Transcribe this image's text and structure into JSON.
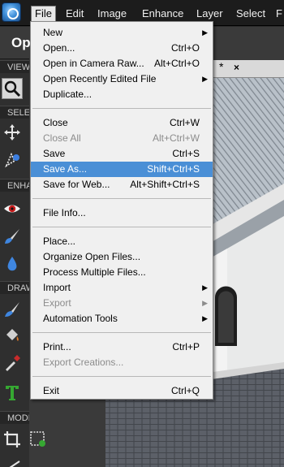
{
  "menubar": {
    "items": [
      "File",
      "Edit",
      "Image",
      "Enhance",
      "Layer",
      "Select",
      "F"
    ]
  },
  "left_panel": {
    "mode": "Op",
    "labels": {
      "view": "VIEW",
      "select": "SELECT",
      "enhance": "ENHANCE",
      "draw": "DRAW",
      "modify": "MODIFY"
    }
  },
  "document_tab": {
    "modified": "*",
    "close": "×"
  },
  "file_menu": {
    "groups": [
      [
        {
          "label": "New",
          "shortcut": "",
          "submenu": true,
          "disabled": false
        },
        {
          "label": "Open...",
          "shortcut": "Ctrl+O",
          "submenu": false,
          "disabled": false
        },
        {
          "label": "Open in Camera Raw...",
          "shortcut": "Alt+Ctrl+O",
          "submenu": false,
          "disabled": false
        },
        {
          "label": "Open Recently Edited File",
          "shortcut": "",
          "submenu": true,
          "disabled": false
        },
        {
          "label": "Duplicate...",
          "shortcut": "",
          "submenu": false,
          "disabled": false
        }
      ],
      [
        {
          "label": "Close",
          "shortcut": "Ctrl+W",
          "submenu": false,
          "disabled": false
        },
        {
          "label": "Close All",
          "shortcut": "Alt+Ctrl+W",
          "submenu": false,
          "disabled": true
        },
        {
          "label": "Save",
          "shortcut": "Ctrl+S",
          "submenu": false,
          "disabled": false
        },
        {
          "label": "Save As...",
          "shortcut": "Shift+Ctrl+S",
          "submenu": false,
          "disabled": false,
          "highlighted": true
        },
        {
          "label": "Save for Web...",
          "shortcut": "Alt+Shift+Ctrl+S",
          "submenu": false,
          "disabled": false
        }
      ],
      [
        {
          "label": "File Info...",
          "shortcut": "",
          "submenu": false,
          "disabled": false
        }
      ],
      [
        {
          "label": "Place...",
          "shortcut": "",
          "submenu": false,
          "disabled": false
        },
        {
          "label": "Organize Open Files...",
          "shortcut": "",
          "submenu": false,
          "disabled": false
        },
        {
          "label": "Process Multiple Files...",
          "shortcut": "",
          "submenu": false,
          "disabled": false
        },
        {
          "label": "Import",
          "shortcut": "",
          "submenu": true,
          "disabled": false
        },
        {
          "label": "Export",
          "shortcut": "",
          "submenu": true,
          "disabled": true
        },
        {
          "label": "Automation Tools",
          "shortcut": "",
          "submenu": true,
          "disabled": false
        }
      ],
      [
        {
          "label": "Print...",
          "shortcut": "Ctrl+P",
          "submenu": false,
          "disabled": false
        },
        {
          "label": "Export Creations...",
          "shortcut": "",
          "submenu": false,
          "disabled": true
        }
      ],
      [
        {
          "label": "Exit",
          "shortcut": "Ctrl+Q",
          "submenu": false,
          "disabled": false
        }
      ]
    ]
  },
  "colors": {
    "menu_highlight": "#4a8fd6",
    "menu_bg": "#f0f0f0",
    "menubar_bg": "#1c1c1c",
    "disabled_text": "#8c8c8c"
  },
  "icons": {
    "app": "app-logo-icon",
    "submenu": "chevron-right-icon"
  }
}
